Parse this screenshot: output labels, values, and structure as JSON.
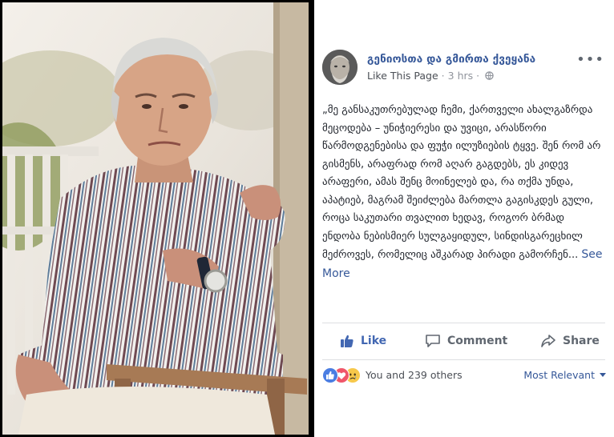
{
  "post": {
    "page_name": "გენიოსთა და გმირთა ქვეყანა",
    "like_page": "Like This Page",
    "time": "3 hrs",
    "body": "„მე განსაკუთრებულად ჩემი, ქართველი ახალგაზრდა მეცოდება – უნიჭიერესი და უვიცი, არასწორი წარმოდგენებისა და ფუჭი ილუზიების ტყვე. შენ რომ არ გისმენს, არაფრად რომ აღარ გაგდებს, ეს კიდევ არაფერი, ამას შენც მოინელებ და, რა თქმა უნდა, აპატიებ, მაგრამ შეიძლება მართლა გაგისკდეს გული, როცა საკუთარი თვალით ხედავ, როგორ ბრმად ენდობა ნებისმიერ სულგაყიდულ, სინდისგარეცხილ მეძროვეს, რომელიც აშკარად პირადი გამორჩენ...",
    "see_more": "See More"
  },
  "actions": {
    "like": "Like",
    "comment": "Comment",
    "share": "Share"
  },
  "reactions": {
    "count_text": "You and 239 others",
    "sort_label": "Most Relevant",
    "icons": [
      "like-reaction",
      "love-reaction",
      "sad-reaction"
    ]
  },
  "colors": {
    "link_blue": "#365899",
    "like_blue": "#4267b2",
    "muted": "#90949c"
  }
}
